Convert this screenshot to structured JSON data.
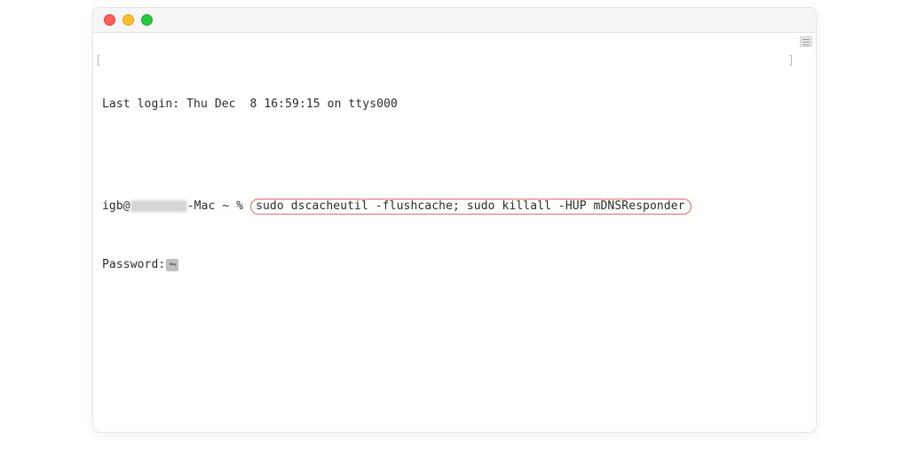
{
  "lastLoginLine": "Last login: Thu Dec  8 16:59:15 on ttys000",
  "prompt": {
    "userPart": "igb@",
    "hostSuffix": "-Mac ~ %",
    "command": "sudo dscacheutil -flushcache; sudo killall -HUP mDNSResponder"
  },
  "passwordLabel": "Password:",
  "brackets": {
    "left": "[",
    "right": "]"
  }
}
